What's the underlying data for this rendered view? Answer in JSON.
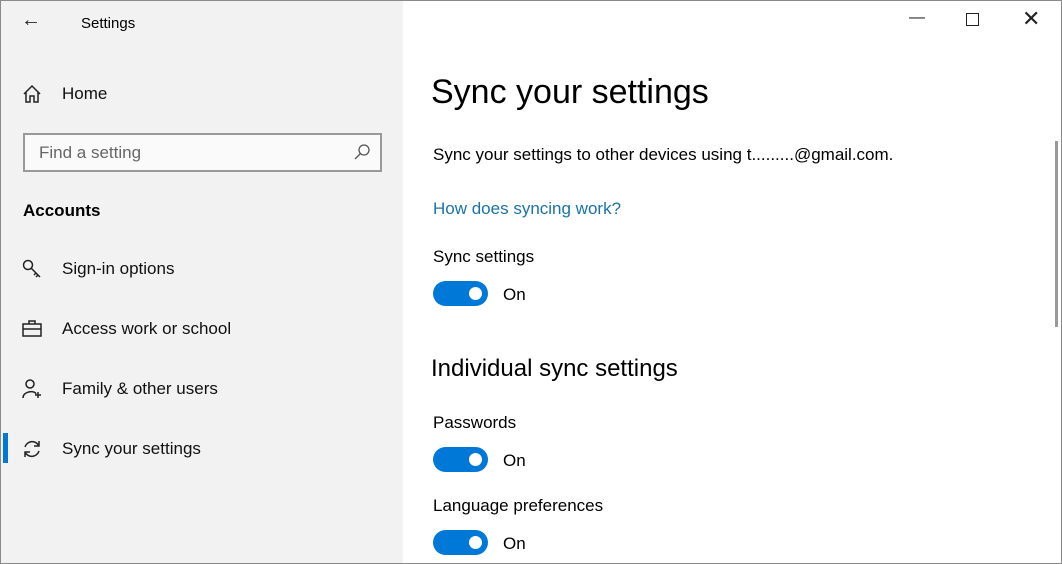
{
  "window": {
    "title": "Settings",
    "back_icon": "back-arrow-icon",
    "controls": [
      "minimize",
      "maximize",
      "close"
    ]
  },
  "sidebar": {
    "home": "Home",
    "search_placeholder": "Find a setting",
    "section": "Accounts",
    "items": [
      {
        "label": "Sign-in options",
        "icon": "key-icon"
      },
      {
        "label": "Access work or school",
        "icon": "briefcase-icon"
      },
      {
        "label": "Family & other users",
        "icon": "person-add-icon"
      },
      {
        "label": "Sync your settings",
        "icon": "sync-icon",
        "selected": true
      }
    ]
  },
  "main": {
    "title": "Sync your settings",
    "description": "Sync your settings to other devices using t.........@gmail.com.",
    "link": "How does syncing work?",
    "sync_label": "Sync settings",
    "sync_state": "On",
    "section": "Individual sync settings",
    "toggles": [
      {
        "label": "Passwords",
        "state": "On"
      },
      {
        "label": "Language preferences",
        "state": "On"
      }
    ]
  },
  "colors": {
    "accent": "#0078d7",
    "link": "#1a73a8"
  }
}
